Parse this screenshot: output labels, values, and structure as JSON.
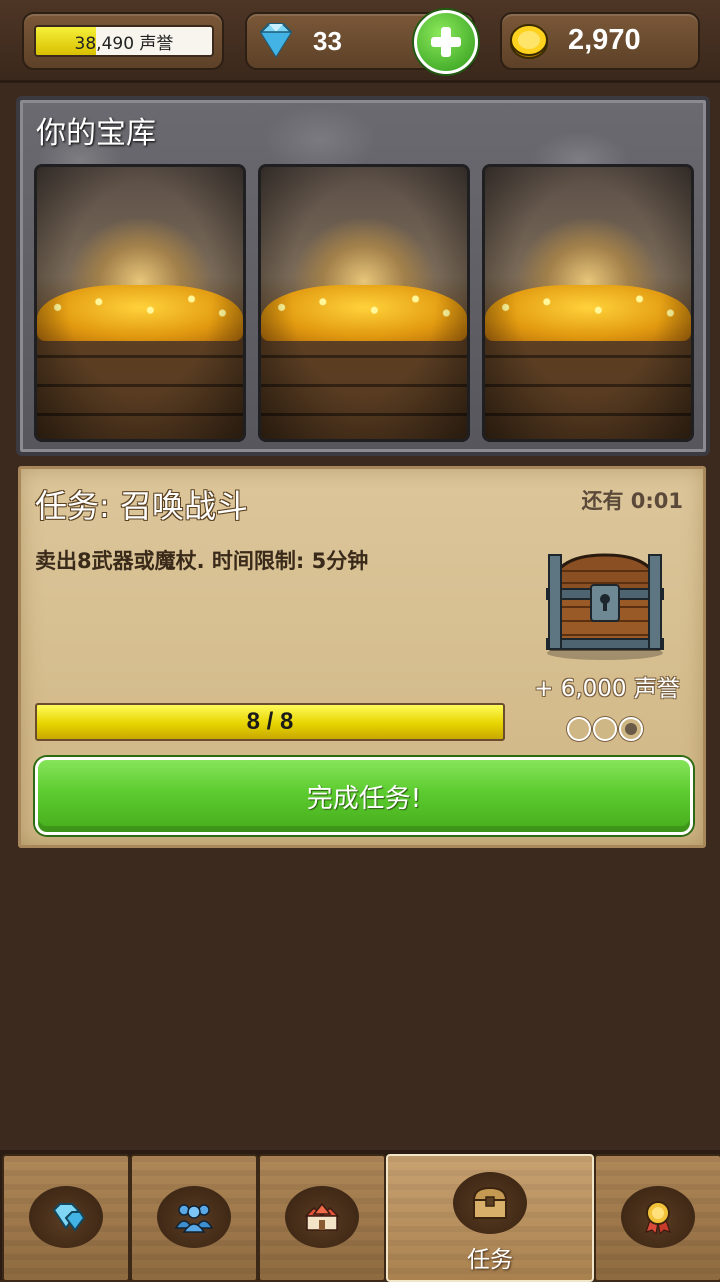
{
  "topbar": {
    "reputation_label": "38,490 声誉",
    "reputation_progress_fraction": 0.34,
    "gems": "33",
    "gold": "2,970"
  },
  "treasury": {
    "title": "你的宝库",
    "slots": [
      {
        "icon": "gold-pile"
      },
      {
        "icon": "gold-pile"
      },
      {
        "icon": "gold-pile"
      }
    ]
  },
  "quest": {
    "title": "任务: 召唤战斗",
    "timer": "还有 0:01",
    "description": "卖出8武器或魔杖. 时间限制: 5分钟",
    "reward": "+ 6,000 声誉",
    "progress_text": "8 / 8",
    "progress_fraction": 1.0,
    "stars_filled": 1,
    "stars_total": 3,
    "complete_button": "完成任务!",
    "reward_icon": "treasure-chest"
  },
  "nav": {
    "tabs": [
      {
        "icon": "gems-icon",
        "label": ""
      },
      {
        "icon": "people-icon",
        "label": ""
      },
      {
        "icon": "buildings-icon",
        "label": ""
      },
      {
        "icon": "chest-icon",
        "label": "任务",
        "active": true
      },
      {
        "icon": "medal-icon",
        "label": ""
      }
    ]
  },
  "colors": {
    "accent_green": "#5ccb2f",
    "progress_yellow": "#e7d400",
    "background": "#3d2a1e"
  }
}
